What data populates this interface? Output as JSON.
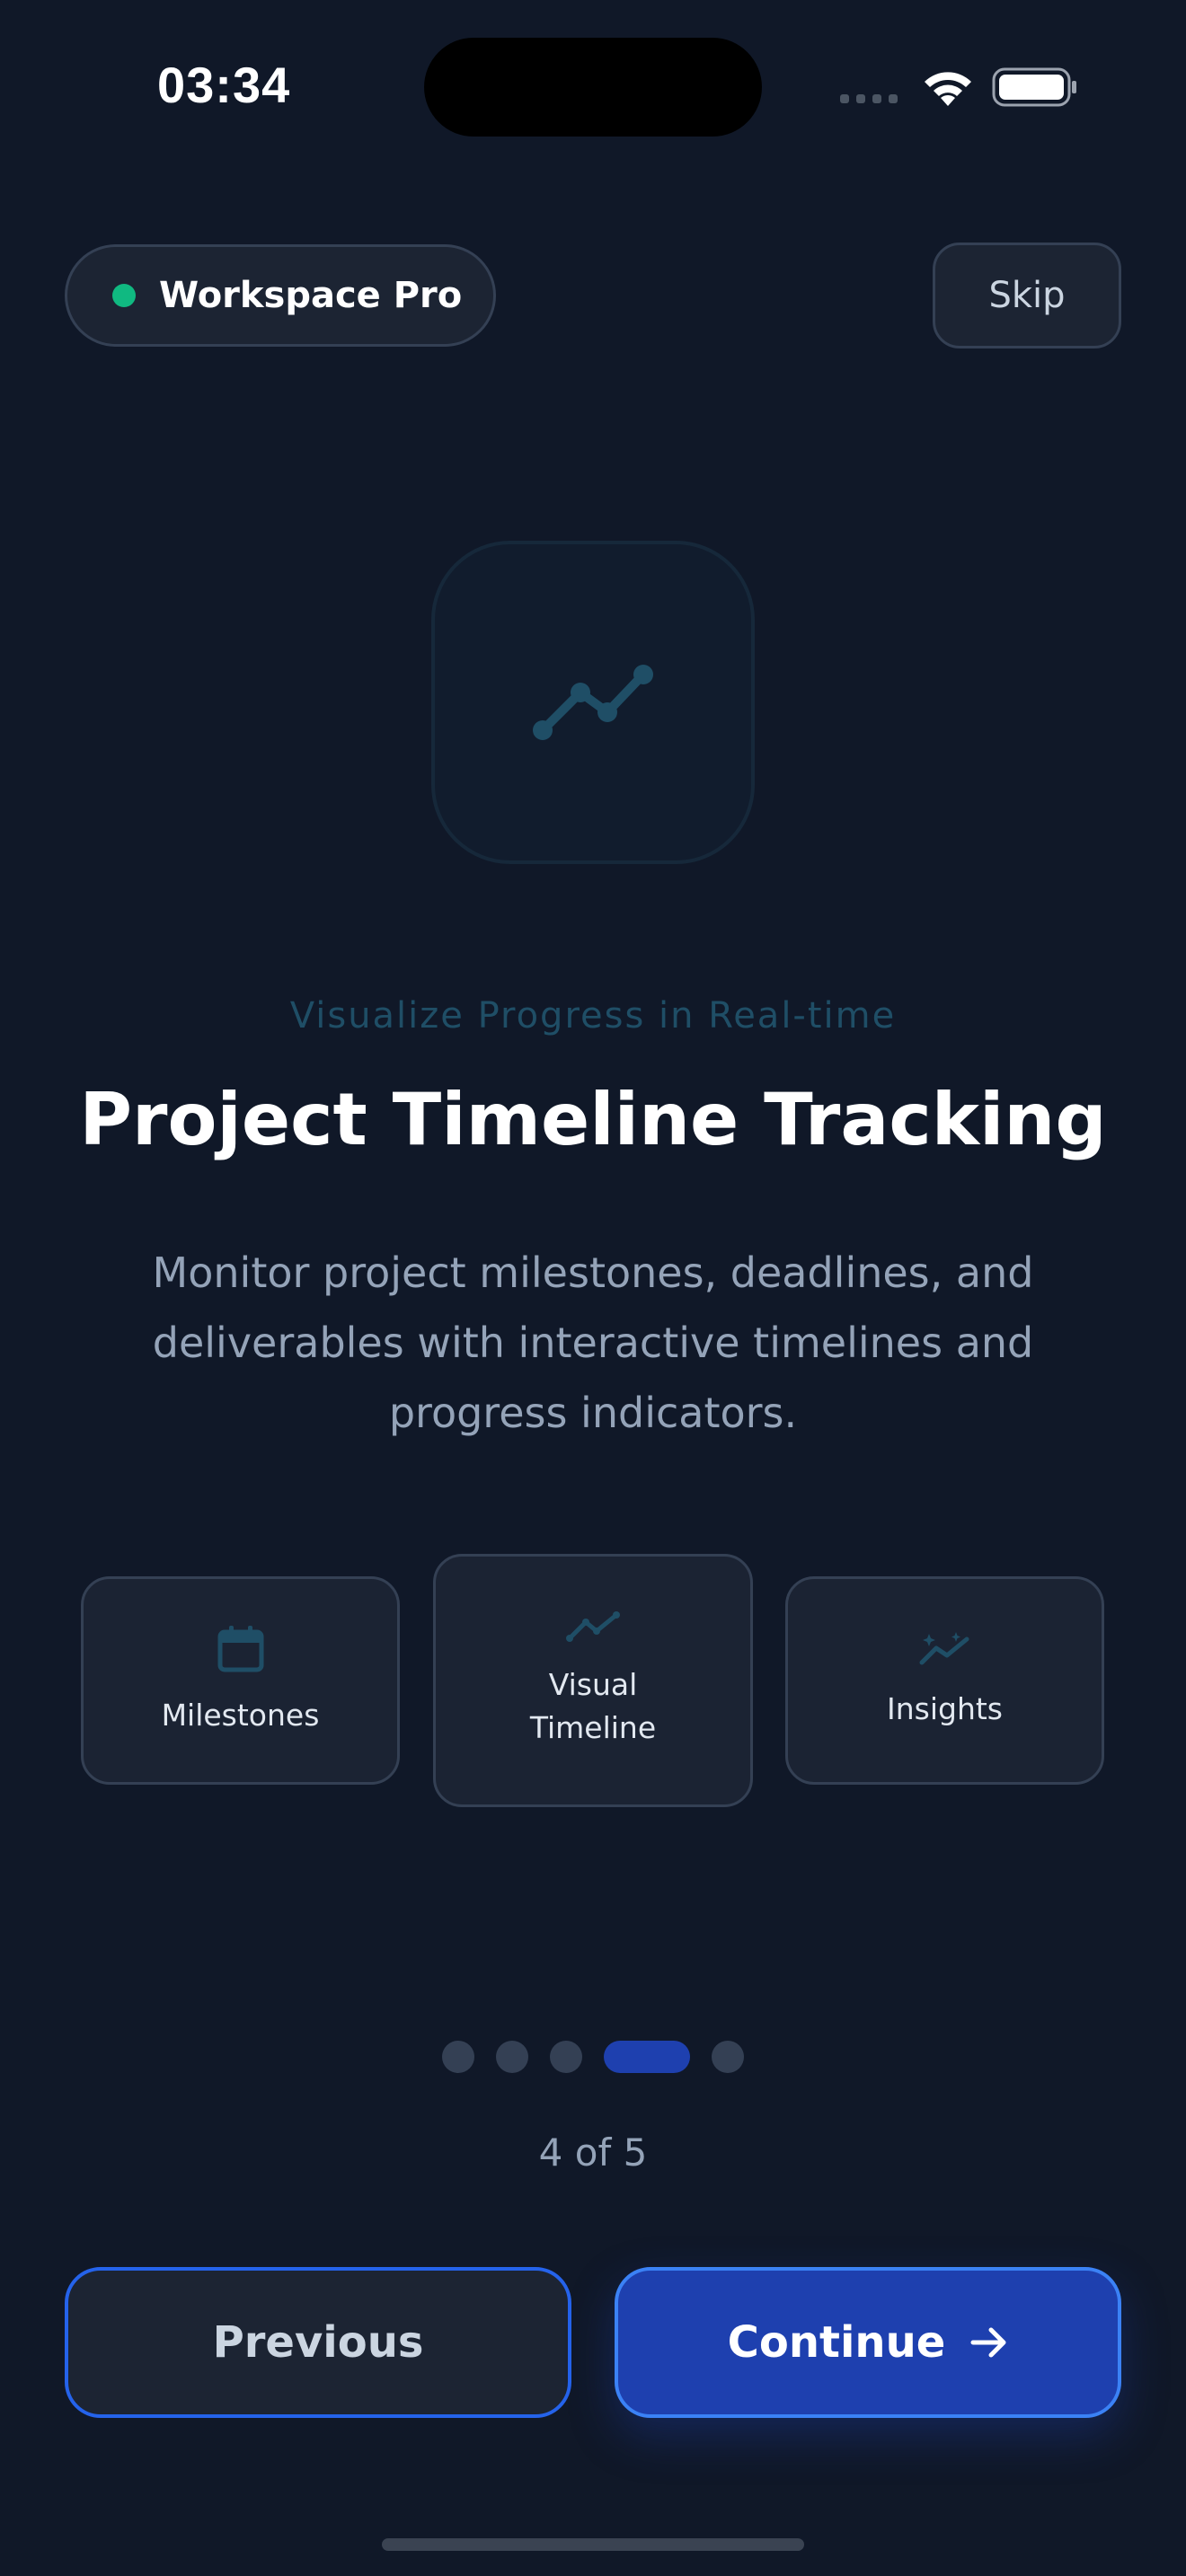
{
  "status_bar": {
    "time": "03:34",
    "icons": [
      "signal-dots-icon",
      "wifi-icon",
      "battery-icon"
    ]
  },
  "header": {
    "brand_label": "Workspace Pro",
    "brand_status_color": "#10b981",
    "skip_label": "Skip"
  },
  "hero": {
    "icon": "trend-line-icon",
    "subtitle": "Visualize Progress in Real-time",
    "title": "Project Timeline Tracking",
    "description": "Monitor project milestones, deadlines, and deliverables with interactive timelines and progress indicators."
  },
  "features": [
    {
      "icon": "calendar-icon",
      "label": "Milestones"
    },
    {
      "icon": "trend-line-icon",
      "label": "Visual Timeline"
    },
    {
      "icon": "sparkle-trend-icon",
      "label": "Insights"
    }
  ],
  "pagination": {
    "current": 4,
    "total": 5,
    "counter_text": "4 of 5"
  },
  "footer": {
    "previous_label": "Previous",
    "continue_label": "Continue",
    "continue_icon": "arrow-right-icon"
  },
  "colors": {
    "background": "#101828",
    "accent": "#1e40af",
    "accent_border": "#3b82f6",
    "muted_icon": "#1f4e66"
  }
}
